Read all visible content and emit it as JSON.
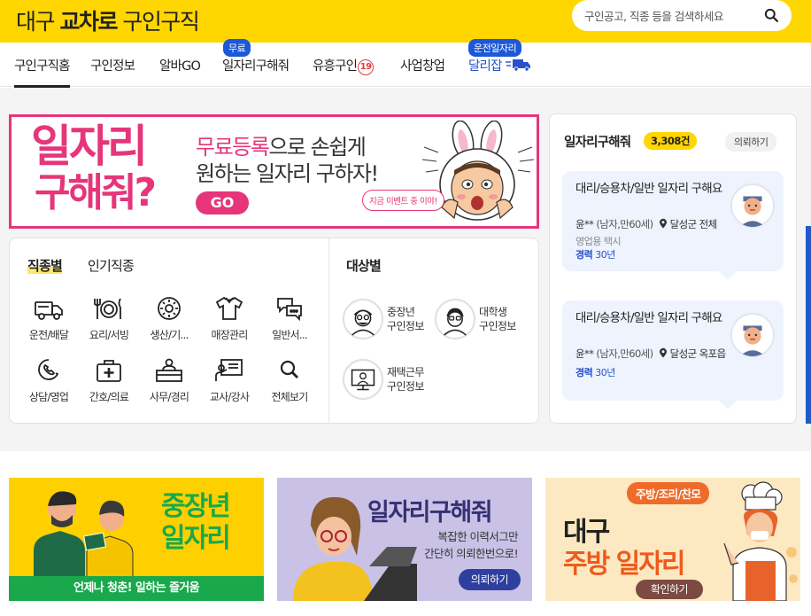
{
  "header": {
    "logo_prefix": "대구 ",
    "logo_bold": "교차로",
    "logo_suffix": " 구인구직",
    "search_placeholder": "구인공고, 직종 등을 검색하세요"
  },
  "nav": {
    "items": [
      {
        "label": "구인구직홈",
        "active": true
      },
      {
        "label": "구인정보"
      },
      {
        "label": "알바GO"
      },
      {
        "label": "일자리구해줘",
        "badge": "무료"
      },
      {
        "label": "유흥구인",
        "age_badge": "19"
      },
      {
        "label": "사업창업"
      },
      {
        "label": "달리잡",
        "badge": "운전일자리"
      }
    ]
  },
  "banner": {
    "big_line1": "일자리",
    "big_line2": "구해줘?",
    "line1_highlight": "무료등록",
    "line1_rest": "으로 손쉽게",
    "line2": "원하는 일자리 구하자!",
    "go": "GO",
    "speech": "지금 이벤트 중 이야!"
  },
  "categories": {
    "tab_selected": "직종별",
    "tab_other": "인기직종",
    "items": [
      {
        "label": "운전/배달",
        "icon": "truck-icon"
      },
      {
        "label": "요리/서빙",
        "icon": "dish-icon"
      },
      {
        "label": "생산/기...",
        "icon": "gear-icon"
      },
      {
        "label": "매장관리",
        "icon": "shirt-icon"
      },
      {
        "label": "일반서...",
        "icon": "chat-icon"
      },
      {
        "label": "상담/영업",
        "icon": "phone-icon"
      },
      {
        "label": "간호/의료",
        "icon": "medical-kit-icon"
      },
      {
        "label": "사무/경리",
        "icon": "desk-icon"
      },
      {
        "label": "교사/강사",
        "icon": "teacher-icon"
      },
      {
        "label": "전체보기",
        "icon": "search-icon"
      }
    ],
    "target_title": "대상별",
    "targets": [
      {
        "l1": "중장년",
        "l2": "구인정보",
        "icon": "elder-avatar-icon"
      },
      {
        "l1": "대학생",
        "l2": "구인정보",
        "icon": "student-avatar-icon"
      },
      {
        "l1": "재택근무",
        "l2": "구인정보",
        "icon": "remote-work-icon"
      }
    ]
  },
  "job_request": {
    "title": "일자리구해줘",
    "count": "3,308건",
    "request_button": "의뢰하기",
    "cards": [
      {
        "title": "대리/승용차/일반 일자리 구해요",
        "name": "윤**",
        "meta": "(남자,만60세)",
        "location": "달성군 전체",
        "sub": "영업용 택시",
        "exp_label": "경력",
        "exp_value": "30년"
      },
      {
        "title": "대리/승용차/일반 일자리 구해요",
        "name": "윤**",
        "meta": "(남자,만60세)",
        "location": "달성군 옥포읍",
        "sub": "",
        "exp_label": "경력",
        "exp_value": "30년"
      }
    ]
  },
  "promos": {
    "p1": {
      "l1": "중장년",
      "l2": "일자리",
      "bar": "언제나 청춘! 일하는 즐거움"
    },
    "p2": {
      "title": "일자리구해줘",
      "s1": "복잡한 이력서그만",
      "s2": "간단히 의뢰한번으로!",
      "btn": "의뢰하기"
    },
    "p3": {
      "pill": "주방/조리/찬모",
      "t1": "대구",
      "t2": "주방 일자리",
      "btn": "확인하기"
    }
  },
  "colors": {
    "brand_yellow": "#ffd600",
    "pink": "#e6357a",
    "blue": "#2852c9",
    "green": "#19a84c"
  }
}
